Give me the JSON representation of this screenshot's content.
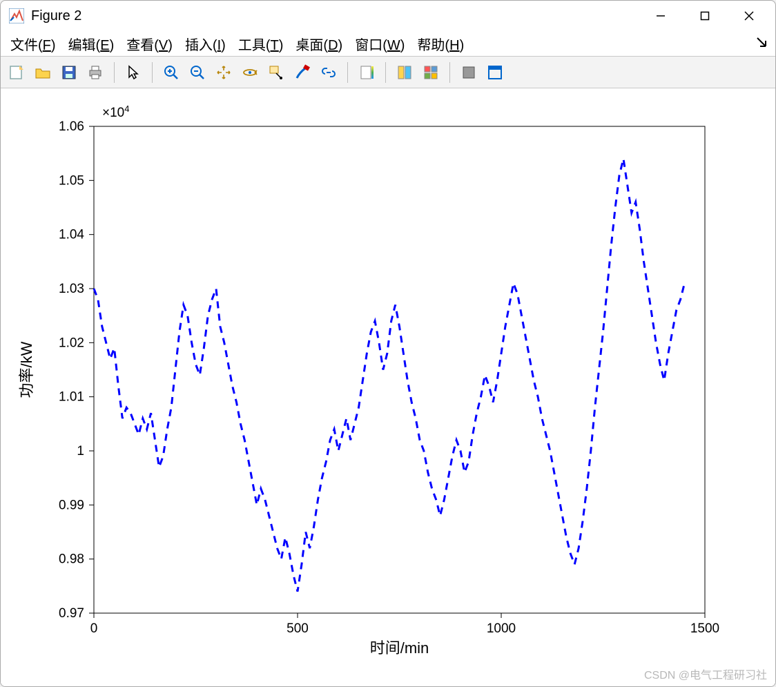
{
  "window": {
    "title": "Figure 2",
    "buttons": {
      "minimize": "minimize",
      "maximize": "maximize",
      "close": "close"
    }
  },
  "menu": {
    "items": [
      {
        "label": "文件",
        "mn": "F"
      },
      {
        "label": "编辑",
        "mn": "E"
      },
      {
        "label": "查看",
        "mn": "V"
      },
      {
        "label": "插入",
        "mn": "I"
      },
      {
        "label": "工具",
        "mn": "T"
      },
      {
        "label": "桌面",
        "mn": "D"
      },
      {
        "label": "窗口",
        "mn": "W"
      },
      {
        "label": "帮助",
        "mn": "H"
      }
    ]
  },
  "toolbar": {
    "icons": [
      "new-figure",
      "open-file",
      "save",
      "print",
      "|",
      "pointer",
      "|",
      "zoom-in",
      "zoom-out",
      "pan",
      "rotate3d",
      "data-cursor",
      "brush",
      "link",
      "|",
      "colorbar",
      "|",
      "colormap-editor",
      "plot-layout",
      "|",
      "hide-tools",
      "dock-figure"
    ]
  },
  "watermark": "CSDN @电气工程研习社",
  "chart_data": {
    "type": "line",
    "style": "dashed",
    "color": "#0000ff",
    "xlabel": "时间/min",
    "ylabel": "功率/kW",
    "y_exponent_label": "×10^4",
    "xlim": [
      0,
      1500
    ],
    "ylim": [
      0.97,
      1.06
    ],
    "xticks": [
      0,
      500,
      1000,
      1500
    ],
    "yticks": [
      0.97,
      0.98,
      0.99,
      1.0,
      1.01,
      1.02,
      1.03,
      1.04,
      1.05,
      1.06
    ],
    "x": [
      0,
      10,
      20,
      30,
      40,
      50,
      60,
      70,
      80,
      90,
      100,
      110,
      120,
      130,
      140,
      150,
      160,
      170,
      180,
      190,
      200,
      210,
      220,
      230,
      240,
      250,
      260,
      270,
      280,
      290,
      300,
      310,
      320,
      330,
      340,
      350,
      360,
      370,
      380,
      390,
      400,
      410,
      420,
      430,
      440,
      450,
      460,
      470,
      480,
      490,
      500,
      510,
      520,
      530,
      540,
      550,
      560,
      570,
      580,
      590,
      600,
      610,
      620,
      630,
      640,
      650,
      660,
      670,
      680,
      690,
      700,
      710,
      720,
      730,
      740,
      750,
      760,
      770,
      780,
      790,
      800,
      810,
      820,
      830,
      840,
      850,
      860,
      870,
      880,
      890,
      900,
      910,
      920,
      930,
      940,
      950,
      960,
      970,
      980,
      990,
      1000,
      1010,
      1020,
      1030,
      1040,
      1050,
      1060,
      1070,
      1080,
      1090,
      1100,
      1110,
      1120,
      1130,
      1140,
      1150,
      1160,
      1170,
      1180,
      1190,
      1200,
      1210,
      1220,
      1230,
      1240,
      1250,
      1260,
      1270,
      1280,
      1290,
      1300,
      1310,
      1320,
      1330,
      1340,
      1350,
      1360,
      1370,
      1380,
      1390,
      1400,
      1410,
      1420,
      1430,
      1440,
      1450
    ],
    "y_scaled": [
      1.03,
      1.028,
      1.023,
      1.02,
      1.017,
      1.019,
      1.012,
      1.006,
      1.008,
      1.007,
      1.005,
      1.003,
      1.006,
      1.004,
      1.007,
      1.002,
      0.997,
      0.999,
      1.004,
      1.008,
      1.015,
      1.022,
      1.027,
      1.025,
      1.02,
      1.016,
      1.014,
      1.019,
      1.025,
      1.028,
      1.03,
      1.023,
      1.02,
      1.016,
      1.012,
      1.009,
      1.005,
      1.002,
      0.998,
      0.994,
      0.99,
      0.993,
      0.991,
      0.988,
      0.985,
      0.982,
      0.98,
      0.984,
      0.981,
      0.977,
      0.974,
      0.979,
      0.985,
      0.982,
      0.986,
      0.991,
      0.995,
      0.998,
      1.002,
      1.004,
      1.0,
      1.003,
      1.006,
      1.002,
      1.005,
      1.008,
      1.013,
      1.018,
      1.022,
      1.024,
      1.02,
      1.015,
      1.018,
      1.024,
      1.027,
      1.023,
      1.018,
      1.013,
      1.009,
      1.006,
      1.002,
      1.0,
      0.996,
      0.993,
      0.991,
      0.988,
      0.991,
      0.995,
      0.999,
      1.002,
      1.0,
      0.996,
      0.998,
      1.003,
      1.007,
      1.01,
      1.014,
      1.012,
      1.009,
      1.013,
      1.018,
      1.023,
      1.027,
      1.031,
      1.029,
      1.025,
      1.021,
      1.017,
      1.013,
      1.01,
      1.006,
      1.003,
      1.0,
      0.996,
      0.992,
      0.988,
      0.984,
      0.981,
      0.979,
      0.982,
      0.987,
      0.993,
      1.0,
      1.008,
      1.015,
      1.022,
      1.03,
      1.038,
      1.045,
      1.051,
      1.054,
      1.049,
      1.044,
      1.046,
      1.041,
      1.035,
      1.03,
      1.025,
      1.02,
      1.016,
      1.013,
      1.018,
      1.022,
      1.026,
      1.028,
      1.031
    ],
    "note": "y values are the plotted numbers scaled by 1e4 (e.g. 1.03 → 10300 kW)"
  }
}
